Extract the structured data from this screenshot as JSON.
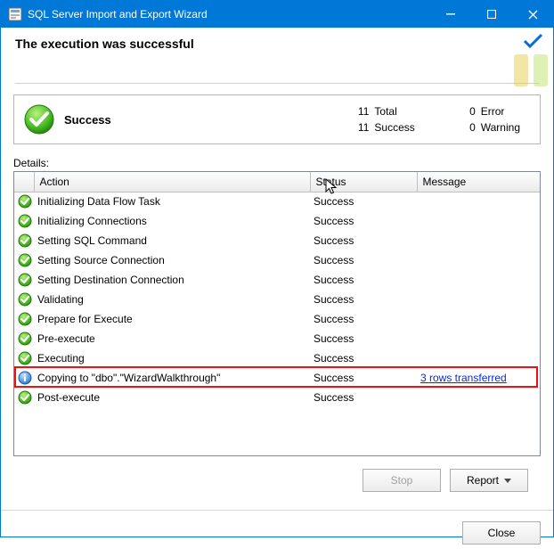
{
  "window": {
    "title": "SQL Server Import and Export Wizard"
  },
  "header": {
    "title": "The execution was successful"
  },
  "summary": {
    "label": "Success",
    "total_n": "11",
    "total_label": "Total",
    "success_n": "11",
    "success_label": "Success",
    "error_n": "0",
    "error_label": "Error",
    "warning_n": "0",
    "warning_label": "Warning"
  },
  "details": {
    "label": "Details:",
    "columns": {
      "action": "Action",
      "status": "Status",
      "message": "Message"
    },
    "rows": [
      {
        "icon": "success",
        "action": "Initializing Data Flow Task",
        "status": "Success",
        "message": ""
      },
      {
        "icon": "success",
        "action": "Initializing Connections",
        "status": "Success",
        "message": ""
      },
      {
        "icon": "success",
        "action": "Setting SQL Command",
        "status": "Success",
        "message": ""
      },
      {
        "icon": "success",
        "action": "Setting Source Connection",
        "status": "Success",
        "message": ""
      },
      {
        "icon": "success",
        "action": "Setting Destination Connection",
        "status": "Success",
        "message": ""
      },
      {
        "icon": "success",
        "action": "Validating",
        "status": "Success",
        "message": ""
      },
      {
        "icon": "success",
        "action": "Prepare for Execute",
        "status": "Success",
        "message": ""
      },
      {
        "icon": "success",
        "action": "Pre-execute",
        "status": "Success",
        "message": ""
      },
      {
        "icon": "success",
        "action": "Executing",
        "status": "Success",
        "message": ""
      },
      {
        "icon": "info",
        "action": "Copying to \"dbo\".\"WizardWalkthrough\"",
        "status": "Success",
        "message": "3 rows transferred",
        "message_link": true,
        "highlight": true
      },
      {
        "icon": "success",
        "action": "Post-execute",
        "status": "Success",
        "message": ""
      }
    ]
  },
  "buttons": {
    "stop": "Stop",
    "report": "Report",
    "close": "Close"
  }
}
